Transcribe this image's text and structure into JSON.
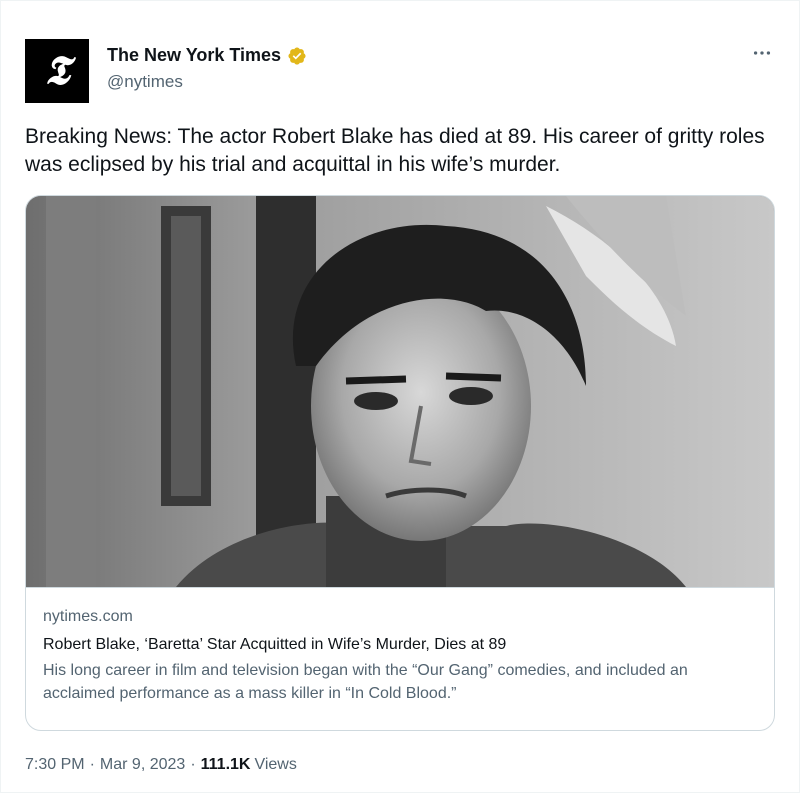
{
  "author": {
    "display_name": "The New York Times",
    "handle": "@nytimes",
    "avatar_glyph": "𝕿",
    "verified_color": "#e2b719",
    "verified_icon": "verified-badge-icon"
  },
  "more_icon": "more-options-icon",
  "tweet_text": "Breaking News: The actor Robert Blake has died at 89. His career of gritty roles was eclipsed by his trial and acquittal in his wife’s murder.",
  "card": {
    "domain": "nytimes.com",
    "title": "Robert Blake, ‘Baretta’ Star Acquitted in Wife’s Murder, Dies at 89",
    "description": "His long career in film and television began with the “Our Gang” comedies, and included an acclaimed performance as a mass killer in “In Cold Blood.”"
  },
  "meta": {
    "time": "7:30 PM",
    "separator": "·",
    "date": "Mar 9, 2023",
    "views_count": "111.1K",
    "views_label": "Views"
  }
}
